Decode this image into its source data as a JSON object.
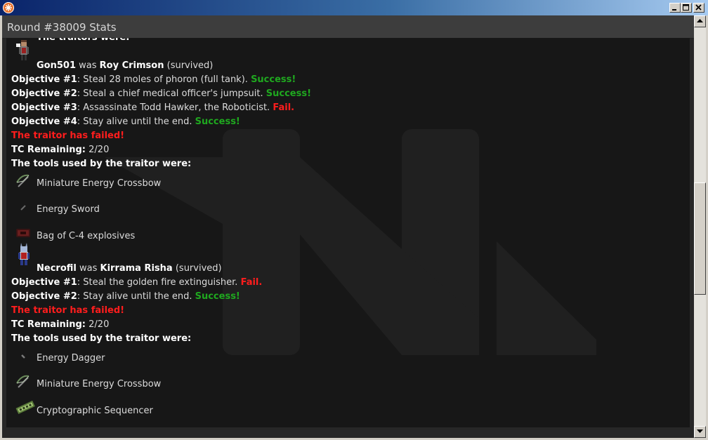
{
  "window": {
    "header_title": "Round #38009 Stats"
  },
  "report": {
    "top_line": "The traitors were:",
    "traitors": [
      {
        "player": "Gon501",
        "was_word": "was",
        "character": "Roy Crimson",
        "status": "(survived)",
        "objectives": [
          {
            "label": "Objective #1",
            "text": "Steal 28 moles of phoron (full tank).",
            "result": "Success!",
            "outcome": "success"
          },
          {
            "label": "Objective #2",
            "text": "Steal a chief medical officer's jumpsuit.",
            "result": "Success!",
            "outcome": "success"
          },
          {
            "label": "Objective #3",
            "text": "Assassinate Todd Hawker, the Roboticist.",
            "result": "Fail.",
            "outcome": "fail"
          },
          {
            "label": "Objective #4",
            "text": "Stay alive until the end.",
            "result": "Success!",
            "outcome": "success"
          }
        ],
        "verdict": "The traitor has failed!",
        "tc_label": "TC Remaining:",
        "tc_value": "2/20",
        "tools_heading": "The tools used by the traitor were:",
        "tools": [
          {
            "name": "Miniature Energy Crossbow",
            "icon": "crossbow-icon"
          },
          {
            "name": "Energy Sword",
            "icon": "energy-sword-icon"
          },
          {
            "name": "Bag of C-4 explosives",
            "icon": "c4-bag-icon"
          }
        ]
      },
      {
        "player": "Necrofil",
        "was_word": "was",
        "character": "Kirrama Risha",
        "status": "(survived)",
        "objectives": [
          {
            "label": "Objective #1",
            "text": "Steal the golden fire extinguisher.",
            "result": "Fail.",
            "outcome": "fail"
          },
          {
            "label": "Objective #2",
            "text": "Stay alive until the end.",
            "result": "Success!",
            "outcome": "success"
          }
        ],
        "verdict": "The traitor has failed!",
        "tc_label": "TC Remaining:",
        "tc_value": "2/20",
        "tools_heading": "The tools used by the traitor were:",
        "tools": [
          {
            "name": "Energy Dagger",
            "icon": "energy-dagger-icon"
          },
          {
            "name": "Miniature Energy Crossbow",
            "icon": "crossbow-icon"
          },
          {
            "name": "Cryptographic Sequencer",
            "icon": "emag-icon"
          }
        ]
      }
    ]
  },
  "colors": {
    "success": "#1fa81f",
    "fail": "#ff1d1d",
    "background": "#171717",
    "header": "#3d3d3d"
  }
}
